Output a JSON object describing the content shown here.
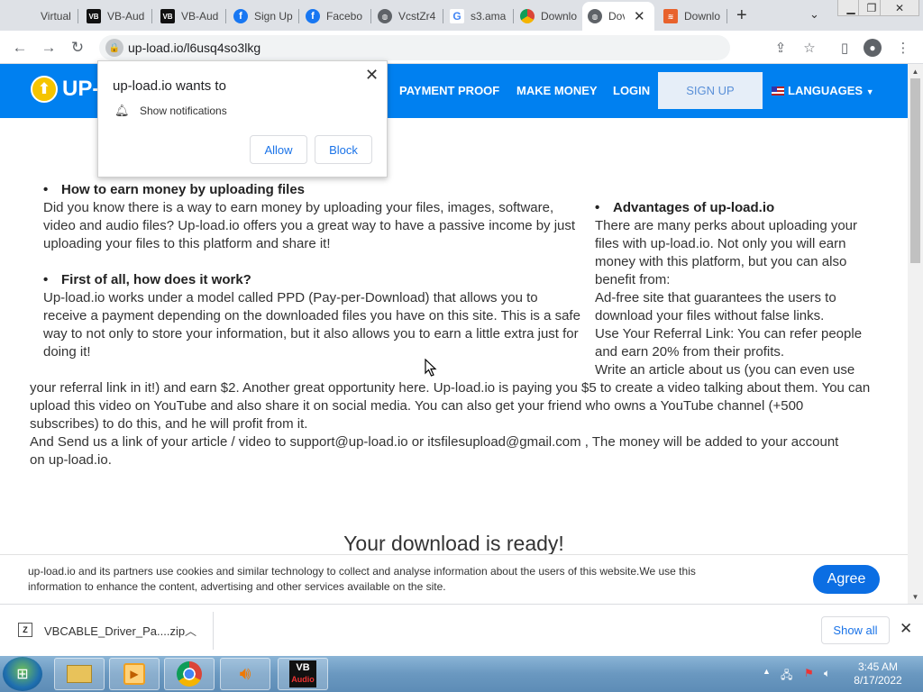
{
  "browser": {
    "tabs": [
      {
        "title": "Virtual",
        "icon": "blank-icon"
      },
      {
        "title": "VB-Aud",
        "icon": "vb-audio-icon"
      },
      {
        "title": "VB-Aud",
        "icon": "vb-audio-icon"
      },
      {
        "title": "Sign Up",
        "icon": "facebook-icon"
      },
      {
        "title": "Facebo",
        "icon": "facebook-icon"
      },
      {
        "title": "VcstZr4",
        "icon": "globe-icon"
      },
      {
        "title": "s3.ama",
        "icon": "google-icon"
      },
      {
        "title": "Downlo",
        "icon": "chrome-icon"
      },
      {
        "title": "Dov",
        "icon": "globe-icon",
        "active": true
      },
      {
        "title": "Downlo",
        "icon": "stack-icon"
      }
    ],
    "new_tab_icon": "plus-icon",
    "url": "up-load.io/l6usq4so3lkg"
  },
  "site": {
    "logo_text": "UP-",
    "nav": [
      "PAYMENT PROOF",
      "MAKE MONEY",
      "LOGIN"
    ],
    "signup": "SIGN UP",
    "languages": "LANGUAGES",
    "brand_color": "#0080f0"
  },
  "content": {
    "left": {
      "b1": "How to earn money by uploading files",
      "p1": "Did you know there is a way to earn money by uploading your files, images, software, video and audio files? Up-load.io offers you a great way to have a passive income by just uploading your files to this platform and share it!",
      "b2": "First of all, how does it work?",
      "p2": "Up-load.io works under a model called PPD (Pay-per-Download) that allows you to receive a payment depending on the downloaded files you have on this site. This is a safe way to not only to store your information, but it also allows you to earn a little extra just for doing it!"
    },
    "right": {
      "b1": "Advantages of up-load.io",
      "p1": "There are many perks about uploading your files with up-load.io. Not only you will earn money with this platform, but you can also benefit from:",
      "p2": "Ad-free site that guarantees the users to download your files without false links.",
      "p3": "Use Your Referral Link: You can refer people and earn 20% from their profits.",
      "p4": "Write an article about us (you can even use"
    },
    "full_1": "your referral link in it!) and earn $2. Another great opportunity here. Up-load.io is paying you $5 to create a video talking about them. You can upload this video on YouTube and also share it on social media. You can also get your friend who owns a YouTube channel (+500 subscribes) to do this, and he will profit from it.",
    "full_2": "And Send us a link of your article / video to support@up-load.io or itsfilesupload@gmail.com , The money will be added to your account on up-load.io.",
    "ready": "Your download is ready!"
  },
  "notification": {
    "title": "up-load.io wants to",
    "message": "Show notifications",
    "allow": "Allow",
    "block": "Block"
  },
  "cookie": {
    "text": "up-load.io and its partners use cookies and similar technology to collect and analyse information about the users of this website.We use this information to enhance the content, advertising and other services available on the site.",
    "agree": "Agree"
  },
  "download": {
    "filename": "VBCABLE_Driver_Pa....zip",
    "show_all": "Show all"
  },
  "taskbar": {
    "time": "3:45 AM",
    "date": "8/17/2022",
    "apps": [
      "explorer-icon",
      "media-player-icon",
      "chrome-icon",
      "speaker-icon",
      "vb-audio-icon"
    ]
  }
}
